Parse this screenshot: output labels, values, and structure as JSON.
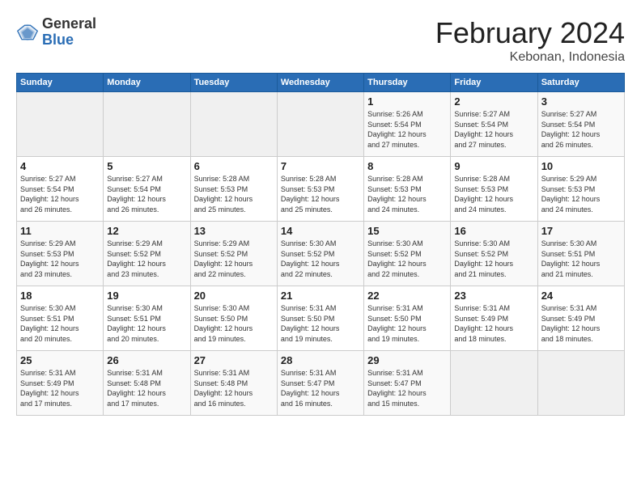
{
  "header": {
    "logo_general": "General",
    "logo_blue": "Blue",
    "month_title": "February 2024",
    "location": "Kebonan, Indonesia"
  },
  "days_of_week": [
    "Sunday",
    "Monday",
    "Tuesday",
    "Wednesday",
    "Thursday",
    "Friday",
    "Saturday"
  ],
  "weeks": [
    [
      {
        "day": "",
        "info": ""
      },
      {
        "day": "",
        "info": ""
      },
      {
        "day": "",
        "info": ""
      },
      {
        "day": "",
        "info": ""
      },
      {
        "day": "1",
        "info": "Sunrise: 5:26 AM\nSunset: 5:54 PM\nDaylight: 12 hours\nand 27 minutes."
      },
      {
        "day": "2",
        "info": "Sunrise: 5:27 AM\nSunset: 5:54 PM\nDaylight: 12 hours\nand 27 minutes."
      },
      {
        "day": "3",
        "info": "Sunrise: 5:27 AM\nSunset: 5:54 PM\nDaylight: 12 hours\nand 26 minutes."
      }
    ],
    [
      {
        "day": "4",
        "info": "Sunrise: 5:27 AM\nSunset: 5:54 PM\nDaylight: 12 hours\nand 26 minutes."
      },
      {
        "day": "5",
        "info": "Sunrise: 5:27 AM\nSunset: 5:54 PM\nDaylight: 12 hours\nand 26 minutes."
      },
      {
        "day": "6",
        "info": "Sunrise: 5:28 AM\nSunset: 5:53 PM\nDaylight: 12 hours\nand 25 minutes."
      },
      {
        "day": "7",
        "info": "Sunrise: 5:28 AM\nSunset: 5:53 PM\nDaylight: 12 hours\nand 25 minutes."
      },
      {
        "day": "8",
        "info": "Sunrise: 5:28 AM\nSunset: 5:53 PM\nDaylight: 12 hours\nand 24 minutes."
      },
      {
        "day": "9",
        "info": "Sunrise: 5:28 AM\nSunset: 5:53 PM\nDaylight: 12 hours\nand 24 minutes."
      },
      {
        "day": "10",
        "info": "Sunrise: 5:29 AM\nSunset: 5:53 PM\nDaylight: 12 hours\nand 24 minutes."
      }
    ],
    [
      {
        "day": "11",
        "info": "Sunrise: 5:29 AM\nSunset: 5:53 PM\nDaylight: 12 hours\nand 23 minutes."
      },
      {
        "day": "12",
        "info": "Sunrise: 5:29 AM\nSunset: 5:52 PM\nDaylight: 12 hours\nand 23 minutes."
      },
      {
        "day": "13",
        "info": "Sunrise: 5:29 AM\nSunset: 5:52 PM\nDaylight: 12 hours\nand 22 minutes."
      },
      {
        "day": "14",
        "info": "Sunrise: 5:30 AM\nSunset: 5:52 PM\nDaylight: 12 hours\nand 22 minutes."
      },
      {
        "day": "15",
        "info": "Sunrise: 5:30 AM\nSunset: 5:52 PM\nDaylight: 12 hours\nand 22 minutes."
      },
      {
        "day": "16",
        "info": "Sunrise: 5:30 AM\nSunset: 5:52 PM\nDaylight: 12 hours\nand 21 minutes."
      },
      {
        "day": "17",
        "info": "Sunrise: 5:30 AM\nSunset: 5:51 PM\nDaylight: 12 hours\nand 21 minutes."
      }
    ],
    [
      {
        "day": "18",
        "info": "Sunrise: 5:30 AM\nSunset: 5:51 PM\nDaylight: 12 hours\nand 20 minutes."
      },
      {
        "day": "19",
        "info": "Sunrise: 5:30 AM\nSunset: 5:51 PM\nDaylight: 12 hours\nand 20 minutes."
      },
      {
        "day": "20",
        "info": "Sunrise: 5:30 AM\nSunset: 5:50 PM\nDaylight: 12 hours\nand 19 minutes."
      },
      {
        "day": "21",
        "info": "Sunrise: 5:31 AM\nSunset: 5:50 PM\nDaylight: 12 hours\nand 19 minutes."
      },
      {
        "day": "22",
        "info": "Sunrise: 5:31 AM\nSunset: 5:50 PM\nDaylight: 12 hours\nand 19 minutes."
      },
      {
        "day": "23",
        "info": "Sunrise: 5:31 AM\nSunset: 5:49 PM\nDaylight: 12 hours\nand 18 minutes."
      },
      {
        "day": "24",
        "info": "Sunrise: 5:31 AM\nSunset: 5:49 PM\nDaylight: 12 hours\nand 18 minutes."
      }
    ],
    [
      {
        "day": "25",
        "info": "Sunrise: 5:31 AM\nSunset: 5:49 PM\nDaylight: 12 hours\nand 17 minutes."
      },
      {
        "day": "26",
        "info": "Sunrise: 5:31 AM\nSunset: 5:48 PM\nDaylight: 12 hours\nand 17 minutes."
      },
      {
        "day": "27",
        "info": "Sunrise: 5:31 AM\nSunset: 5:48 PM\nDaylight: 12 hours\nand 16 minutes."
      },
      {
        "day": "28",
        "info": "Sunrise: 5:31 AM\nSunset: 5:47 PM\nDaylight: 12 hours\nand 16 minutes."
      },
      {
        "day": "29",
        "info": "Sunrise: 5:31 AM\nSunset: 5:47 PM\nDaylight: 12 hours\nand 15 minutes."
      },
      {
        "day": "",
        "info": ""
      },
      {
        "day": "",
        "info": ""
      }
    ]
  ]
}
